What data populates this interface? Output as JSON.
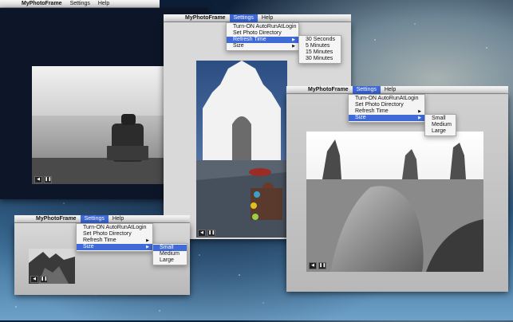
{
  "menubar": {
    "app": "MyPhotoFrame",
    "settings": "Settings",
    "help": "Help"
  },
  "settings_menu": {
    "autorun": "Turn-ON AutoRunAtLogin",
    "photo_dir": "Set Photo Directory",
    "refresh": "Refresh Time",
    "size": "Size"
  },
  "refresh_menu": [
    "30 Seconds",
    "5 Minutes",
    "15 Minutes",
    "30 Minutes"
  ],
  "size_menu": [
    "Small",
    "Medium",
    "Large"
  ],
  "controls": {
    "prev": "◀",
    "pause": "❚❚"
  }
}
